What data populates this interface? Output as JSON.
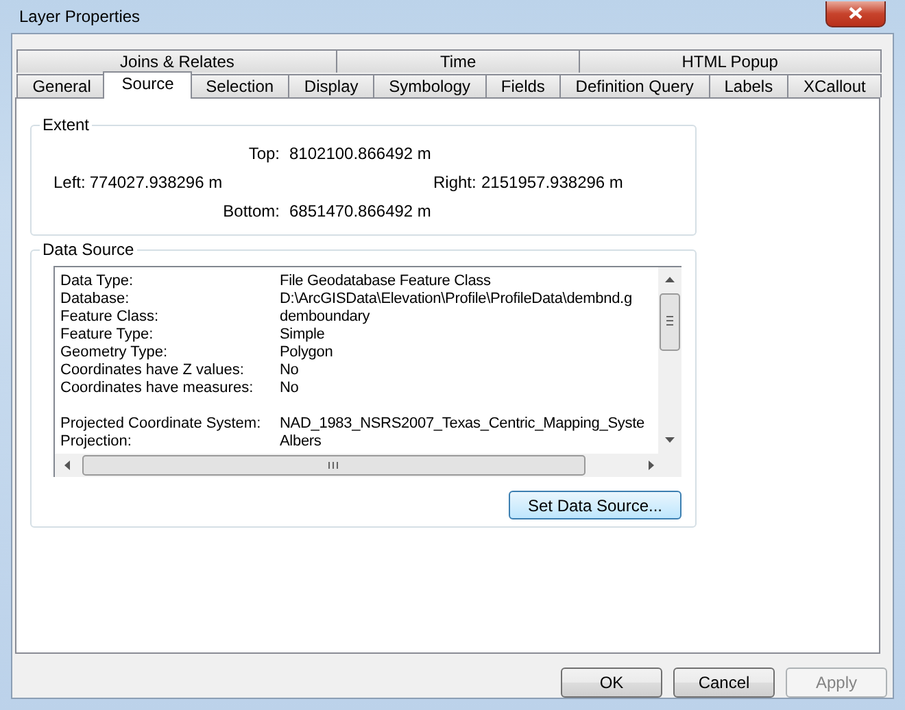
{
  "window": {
    "title": "Layer Properties"
  },
  "tab_rows": [
    [
      {
        "label": "Joins & Relates",
        "selected": false
      },
      {
        "label": "Time",
        "selected": false
      },
      {
        "label": "HTML Popup",
        "selected": false
      }
    ],
    [
      {
        "label": "General",
        "selected": false
      },
      {
        "label": "Source",
        "selected": true
      },
      {
        "label": "Selection",
        "selected": false
      },
      {
        "label": "Display",
        "selected": false
      },
      {
        "label": "Symbology",
        "selected": false
      },
      {
        "label": "Fields",
        "selected": false
      },
      {
        "label": "Definition Query",
        "selected": false
      },
      {
        "label": "Labels",
        "selected": false
      },
      {
        "label": "XCallout",
        "selected": false
      }
    ]
  ],
  "extent": {
    "title": "Extent",
    "top_label": "Top:",
    "top": "8102100.866492 m",
    "left_label": "Left:",
    "left": "774027.938296 m",
    "right_label": "Right:",
    "right": "2151957.938296 m",
    "bottom_label": "Bottom:",
    "bottom": "6851470.866492 m"
  },
  "data_source": {
    "title": "Data Source",
    "properties": [
      {
        "label": "Data Type:",
        "value": "File Geodatabase Feature Class",
        "gap_before": false
      },
      {
        "label": "Database:",
        "value": "D:\\ArcGISData\\Elevation\\Profile\\ProfileData\\dembnd.g",
        "gap_before": false
      },
      {
        "label": "Feature Class:",
        "value": "demboundary",
        "gap_before": false
      },
      {
        "label": "Feature Type:",
        "value": "Simple",
        "gap_before": false
      },
      {
        "label": "Geometry Type:",
        "value": "Polygon",
        "gap_before": false
      },
      {
        "label": "Coordinates have Z values:",
        "value": "No",
        "gap_before": false
      },
      {
        "label": "Coordinates have measures:",
        "value": "No",
        "gap_before": false
      },
      {
        "label": "Projected Coordinate System:",
        "value": "NAD_1983_NSRS2007_Texas_Centric_Mapping_Syste",
        "gap_before": true
      },
      {
        "label": "Projection:",
        "value": "Albers",
        "gap_before": false
      }
    ],
    "button": "Set Data Source..."
  },
  "buttons": [
    {
      "label": "OK",
      "disabled": false
    },
    {
      "label": "Cancel",
      "disabled": false
    },
    {
      "label": "Apply",
      "disabled": true
    }
  ]
}
